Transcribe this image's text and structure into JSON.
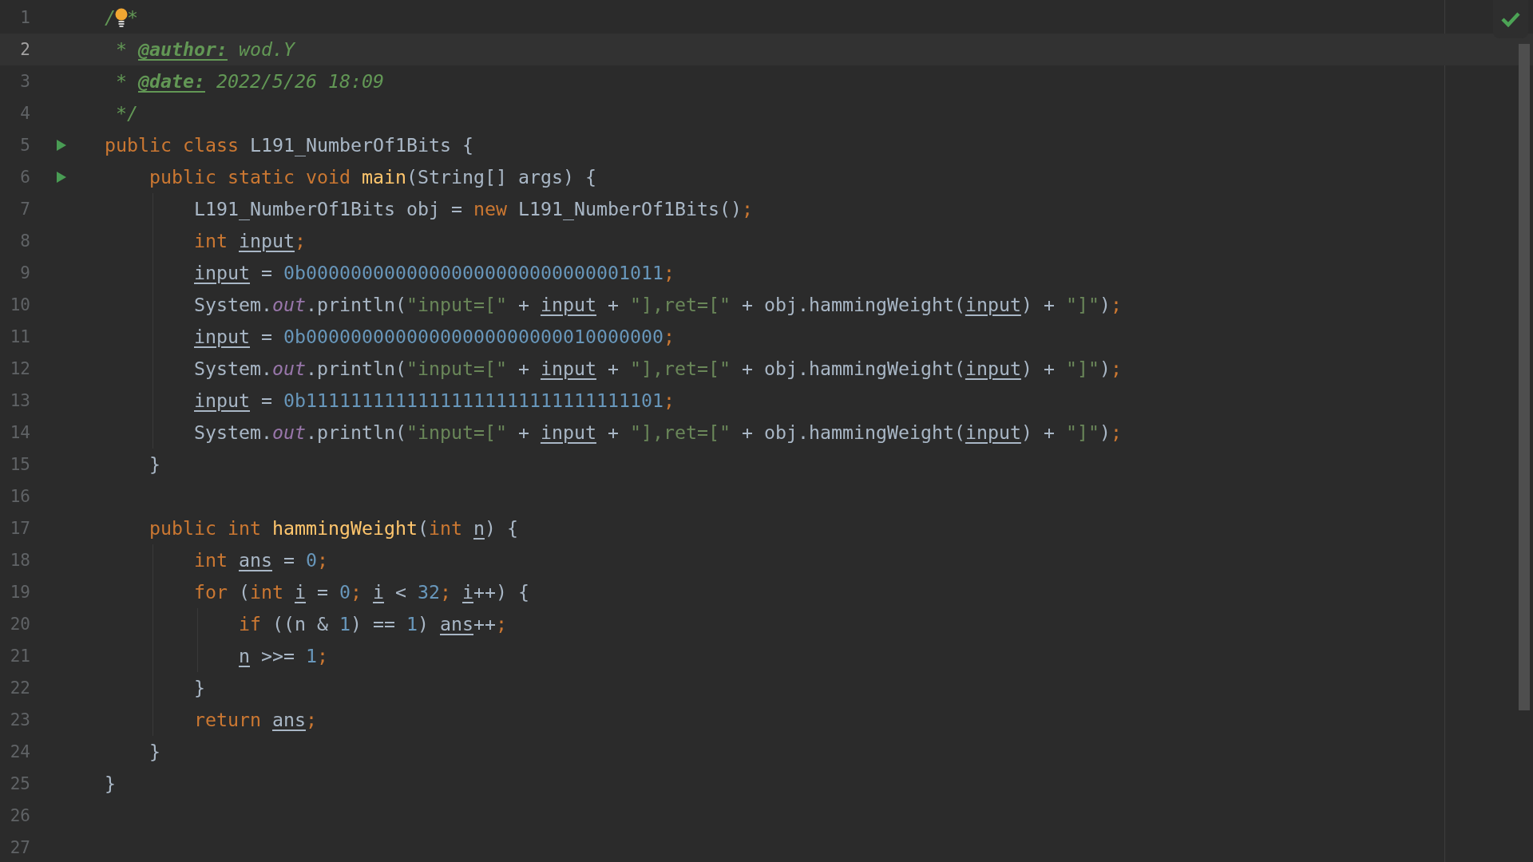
{
  "editor": {
    "lines": [
      {
        "number": "1",
        "selected": false,
        "bulb": true,
        "tokens": [
          {
            "kind": "com",
            "text": "/"
          },
          {
            "kind": "gap"
          },
          {
            "kind": "com",
            "text": "*"
          }
        ]
      },
      {
        "number": "2",
        "selected": true,
        "tokens": [
          {
            "kind": "com",
            "text": " * "
          },
          {
            "kind": "tag",
            "text": "@author:"
          },
          {
            "kind": "com",
            "text": " wod.Y"
          }
        ]
      },
      {
        "number": "3",
        "selected": false,
        "tokens": [
          {
            "kind": "com",
            "text": " * "
          },
          {
            "kind": "tag",
            "text": "@date:"
          },
          {
            "kind": "com",
            "text": " 2022/5/26 18:09"
          }
        ]
      },
      {
        "number": "4",
        "selected": false,
        "tokens": [
          {
            "kind": "com",
            "text": " */"
          }
        ]
      },
      {
        "number": "5",
        "selected": false,
        "run": true,
        "tokens": [
          {
            "kind": "kw",
            "text": "public class "
          },
          {
            "kind": "plain",
            "text": "L191_NumberOf1Bits {"
          }
        ],
        "children": [
          {
            "number": "6",
            "selected": false,
            "run": true,
            "tokens": [
              {
                "kind": "kw",
                "text": "public static void "
              },
              {
                "kind": "fn",
                "text": "main"
              },
              {
                "kind": "plain",
                "text": "(String[] args) {"
              }
            ],
            "children": [
              {
                "number": "7",
                "selected": false,
                "tokens": [
                  {
                    "kind": "plain",
                    "text": "L191_NumberOf1Bits obj = "
                  },
                  {
                    "kind": "kw",
                    "text": "new "
                  },
                  {
                    "kind": "plain",
                    "text": "L191_NumberOf1Bits()"
                  },
                  {
                    "kind": "kw",
                    "text": ";"
                  }
                ]
              },
              {
                "number": "8",
                "selected": false,
                "tokens": [
                  {
                    "kind": "kw",
                    "text": "int "
                  },
                  {
                    "kind": "var",
                    "text": "input"
                  },
                  {
                    "kind": "kw",
                    "text": ";"
                  }
                ]
              },
              {
                "number": "9",
                "selected": false,
                "tokens": [
                  {
                    "kind": "var",
                    "text": "input"
                  },
                  {
                    "kind": "plain",
                    "text": " = "
                  },
                  {
                    "kind": "num",
                    "text": "0b00000000000000000000000000001011"
                  },
                  {
                    "kind": "kw",
                    "text": ";"
                  }
                ]
              },
              {
                "number": "10",
                "selected": false,
                "tokens": [
                  {
                    "kind": "plain",
                    "text": "System."
                  },
                  {
                    "kind": "field",
                    "text": "out"
                  },
                  {
                    "kind": "plain",
                    "text": ".println("
                  },
                  {
                    "kind": "str",
                    "text": "\"input=[\""
                  },
                  {
                    "kind": "plain",
                    "text": " + "
                  },
                  {
                    "kind": "var",
                    "text": "input"
                  },
                  {
                    "kind": "plain",
                    "text": " + "
                  },
                  {
                    "kind": "str",
                    "text": "\"],ret=[\""
                  },
                  {
                    "kind": "plain",
                    "text": " + obj.hammingWeight("
                  },
                  {
                    "kind": "var",
                    "text": "input"
                  },
                  {
                    "kind": "plain",
                    "text": ") + "
                  },
                  {
                    "kind": "str",
                    "text": "\"]\""
                  },
                  {
                    "kind": "plain",
                    "text": ")"
                  },
                  {
                    "kind": "kw",
                    "text": ";"
                  }
                ]
              },
              {
                "number": "11",
                "selected": false,
                "tokens": [
                  {
                    "kind": "var",
                    "text": "input"
                  },
                  {
                    "kind": "plain",
                    "text": " = "
                  },
                  {
                    "kind": "num",
                    "text": "0b00000000000000000000000010000000"
                  },
                  {
                    "kind": "kw",
                    "text": ";"
                  }
                ]
              },
              {
                "number": "12",
                "selected": false,
                "tokens": [
                  {
                    "kind": "plain",
                    "text": "System."
                  },
                  {
                    "kind": "field",
                    "text": "out"
                  },
                  {
                    "kind": "plain",
                    "text": ".println("
                  },
                  {
                    "kind": "str",
                    "text": "\"input=[\""
                  },
                  {
                    "kind": "plain",
                    "text": " + "
                  },
                  {
                    "kind": "var",
                    "text": "input"
                  },
                  {
                    "kind": "plain",
                    "text": " + "
                  },
                  {
                    "kind": "str",
                    "text": "\"],ret=[\""
                  },
                  {
                    "kind": "plain",
                    "text": " + obj.hammingWeight("
                  },
                  {
                    "kind": "var",
                    "text": "input"
                  },
                  {
                    "kind": "plain",
                    "text": ") + "
                  },
                  {
                    "kind": "str",
                    "text": "\"]\""
                  },
                  {
                    "kind": "plain",
                    "text": ")"
                  },
                  {
                    "kind": "kw",
                    "text": ";"
                  }
                ]
              },
              {
                "number": "13",
                "selected": false,
                "tokens": [
                  {
                    "kind": "var",
                    "text": "input"
                  },
                  {
                    "kind": "plain",
                    "text": " = "
                  },
                  {
                    "kind": "num",
                    "text": "0b11111111111111111111111111111101"
                  },
                  {
                    "kind": "kw",
                    "text": ";"
                  }
                ]
              },
              {
                "number": "14",
                "selected": false,
                "tokens": [
                  {
                    "kind": "plain",
                    "text": "System."
                  },
                  {
                    "kind": "field",
                    "text": "out"
                  },
                  {
                    "kind": "plain",
                    "text": ".println("
                  },
                  {
                    "kind": "str",
                    "text": "\"input=[\""
                  },
                  {
                    "kind": "plain",
                    "text": " + "
                  },
                  {
                    "kind": "var",
                    "text": "input"
                  },
                  {
                    "kind": "plain",
                    "text": " + "
                  },
                  {
                    "kind": "str",
                    "text": "\"],ret=[\""
                  },
                  {
                    "kind": "plain",
                    "text": " + obj.hammingWeight("
                  },
                  {
                    "kind": "var",
                    "text": "input"
                  },
                  {
                    "kind": "plain",
                    "text": ") + "
                  },
                  {
                    "kind": "str",
                    "text": "\"]\""
                  },
                  {
                    "kind": "plain",
                    "text": ")"
                  },
                  {
                    "kind": "kw",
                    "text": ";"
                  }
                ]
              }
            ]
          },
          {
            "number": "15",
            "selected": false,
            "tokens": [
              {
                "kind": "plain",
                "text": "}"
              }
            ]
          },
          {
            "number": "16",
            "selected": false
          },
          {
            "number": "17",
            "selected": false,
            "tokens": [
              {
                "kind": "kw",
                "text": "public int "
              },
              {
                "kind": "fn",
                "text": "hammingWeight"
              },
              {
                "kind": "plain",
                "text": "("
              },
              {
                "kind": "kw",
                "text": "int "
              },
              {
                "kind": "var",
                "text": "n"
              },
              {
                "kind": "plain",
                "text": ") {"
              }
            ],
            "children": [
              {
                "number": "18",
                "selected": false,
                "tokens": [
                  {
                    "kind": "kw",
                    "text": "int "
                  },
                  {
                    "kind": "var",
                    "text": "ans"
                  },
                  {
                    "kind": "plain",
                    "text": " = "
                  },
                  {
                    "kind": "num",
                    "text": "0"
                  },
                  {
                    "kind": "kw",
                    "text": ";"
                  }
                ]
              },
              {
                "number": "19",
                "selected": false,
                "tokens": [
                  {
                    "kind": "kw",
                    "text": "for "
                  },
                  {
                    "kind": "plain",
                    "text": "("
                  },
                  {
                    "kind": "kw",
                    "text": "int "
                  },
                  {
                    "kind": "var",
                    "text": "i"
                  },
                  {
                    "kind": "plain",
                    "text": " = "
                  },
                  {
                    "kind": "num",
                    "text": "0"
                  },
                  {
                    "kind": "kw",
                    "text": "; "
                  },
                  {
                    "kind": "var",
                    "text": "i"
                  },
                  {
                    "kind": "plain",
                    "text": " < "
                  },
                  {
                    "kind": "num",
                    "text": "32"
                  },
                  {
                    "kind": "kw",
                    "text": "; "
                  },
                  {
                    "kind": "var",
                    "text": "i"
                  },
                  {
                    "kind": "plain",
                    "text": "++) {"
                  }
                ],
                "children": [
                  {
                    "number": "20",
                    "selected": false,
                    "tokens": [
                      {
                        "kind": "kw",
                        "text": "if "
                      },
                      {
                        "kind": "plain",
                        "text": "((n & "
                      },
                      {
                        "kind": "num",
                        "text": "1"
                      },
                      {
                        "kind": "plain",
                        "text": ") == "
                      },
                      {
                        "kind": "num",
                        "text": "1"
                      },
                      {
                        "kind": "plain",
                        "text": ") "
                      },
                      {
                        "kind": "var",
                        "text": "ans"
                      },
                      {
                        "kind": "plain",
                        "text": "++"
                      },
                      {
                        "kind": "kw",
                        "text": ";"
                      }
                    ]
                  },
                  {
                    "number": "21",
                    "selected": false,
                    "tokens": [
                      {
                        "kind": "var",
                        "text": "n"
                      },
                      {
                        "kind": "plain",
                        "text": " >>= "
                      },
                      {
                        "kind": "num",
                        "text": "1"
                      },
                      {
                        "kind": "kw",
                        "text": ";"
                      }
                    ]
                  }
                ]
              },
              {
                "number": "22",
                "selected": false,
                "tokens": [
                  {
                    "kind": "plain",
                    "text": "}"
                  }
                ]
              },
              {
                "number": "23",
                "selected": false,
                "tokens": [
                  {
                    "kind": "kw",
                    "text": "return "
                  },
                  {
                    "kind": "var",
                    "text": "ans"
                  },
                  {
                    "kind": "kw",
                    "text": ";"
                  }
                ]
              }
            ]
          },
          {
            "number": "24",
            "selected": false,
            "tokens": [
              {
                "kind": "plain",
                "text": "}"
              }
            ]
          }
        ]
      },
      {
        "number": "25",
        "selected": false,
        "tokens": [
          {
            "kind": "plain",
            "text": "}"
          }
        ]
      },
      {
        "number": "26",
        "selected": false
      },
      {
        "number": "27",
        "selected": false
      }
    ]
  }
}
